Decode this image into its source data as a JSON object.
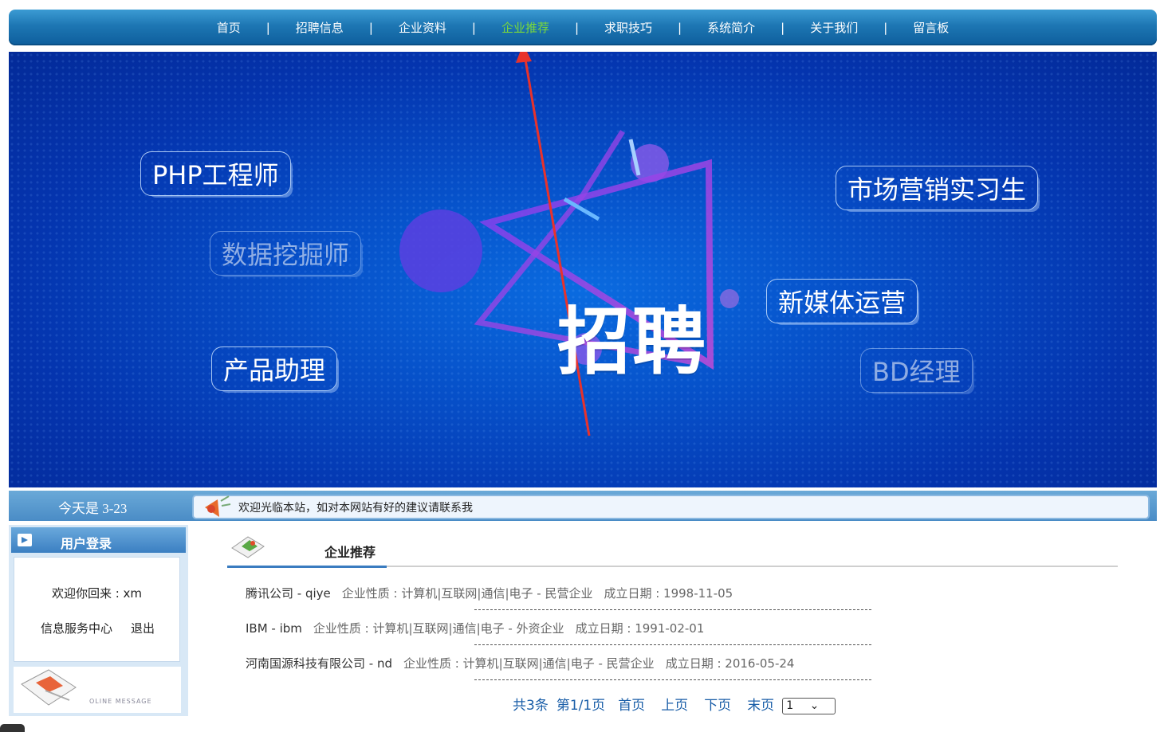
{
  "nav": {
    "items": [
      {
        "label": "首页",
        "active": false
      },
      {
        "label": "招聘信息",
        "active": false
      },
      {
        "label": "企业资料",
        "active": false
      },
      {
        "label": "企业推荐",
        "active": true
      },
      {
        "label": "求职技巧",
        "active": false
      },
      {
        "label": "系统简介",
        "active": false
      },
      {
        "label": "关于我们",
        "active": false
      },
      {
        "label": "留言板",
        "active": false
      }
    ],
    "separator": "|",
    "active_color": "#7ad83b"
  },
  "banner": {
    "hero": "招聘",
    "tags": [
      "PHP工程师",
      "数据挖掘师",
      "产品助理",
      "市场营销实习生",
      "新媒体运营",
      "BD经理"
    ]
  },
  "datebar": {
    "date": "今天是 3-23",
    "notice": "欢迎光临本站，如对本网站有好的建议请联系我"
  },
  "sidebar": {
    "title": "用户登录",
    "welcome": "欢迎你回来 : xm",
    "service_link": "信息服务中心",
    "logout_link": "退出",
    "footer_caption": "OLINE MESSAGE"
  },
  "main": {
    "title": "企业推荐",
    "companies": [
      {
        "name": "腾讯公司 - qiye",
        "nature": "企业性质 : 计算机|互联网|通信|电子 - 民营企业",
        "founded": "成立日期 : 1998-11-05"
      },
      {
        "name": "IBM - ibm",
        "nature": "企业性质 : 计算机|互联网|通信|电子 - 外资企业",
        "founded": "成立日期 : 1991-02-01"
      },
      {
        "name": "河南国源科技有限公司 - nd",
        "nature": "企业性质 : 计算机|互联网|通信|电子 - 民营企业",
        "founded": "成立日期 : 2016-05-24"
      }
    ],
    "pager": {
      "total": "共3条",
      "page": "第1/1页",
      "first": "首页",
      "prev": "上页",
      "next": "下页",
      "last": "末页",
      "select_value": "1"
    }
  },
  "colors": {
    "nav_bg": "#1d76b3",
    "banner_bg": "#064fc8",
    "link": "#1a5ea8"
  }
}
